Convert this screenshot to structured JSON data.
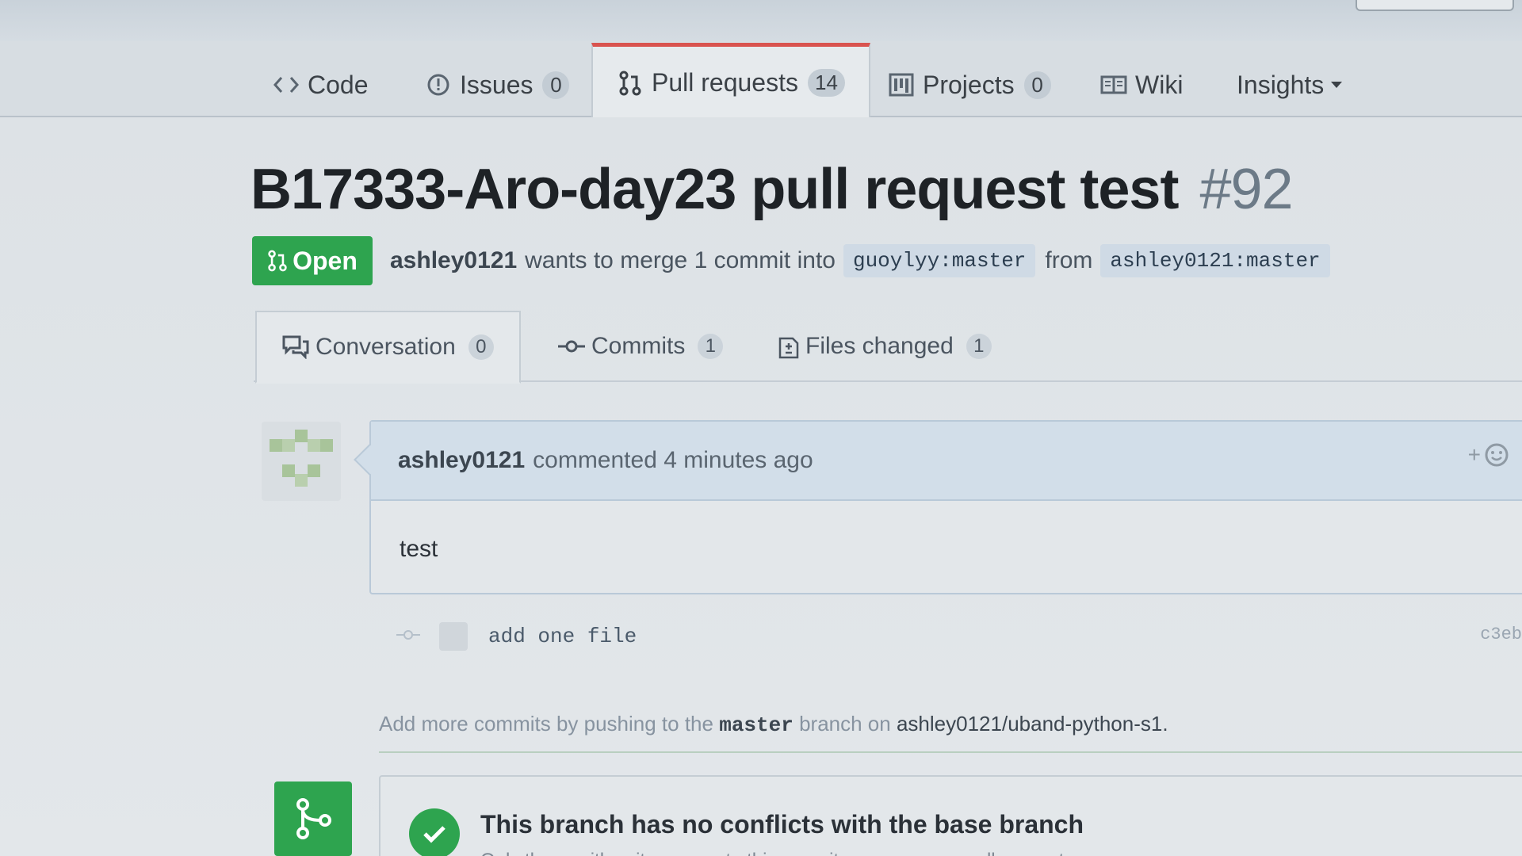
{
  "repo_nav": {
    "tabs": [
      {
        "label": "Code",
        "icon": "code-icon",
        "counter": null
      },
      {
        "label": "Issues",
        "icon": "issue-opened-icon",
        "counter": "0"
      },
      {
        "label": "Pull requests",
        "icon": "git-pull-request-icon",
        "counter": "14",
        "selected": true
      },
      {
        "label": "Projects",
        "icon": "project-icon",
        "counter": "0"
      },
      {
        "label": "Wiki",
        "icon": "book-icon",
        "counter": null
      },
      {
        "label": "Insights",
        "icon": "triangle-down-icon",
        "counter": null
      }
    ]
  },
  "pull_request": {
    "title": "B17333-Aro-day23 pull request test",
    "number": "#92",
    "state": "Open",
    "author": "ashley0121",
    "merge_text": "wants to merge 1 commit into",
    "base_branch": "guoylyy:master",
    "from_text": "from",
    "head_branch": "ashley0121:master"
  },
  "pr_tabs": [
    {
      "label": "Conversation",
      "icon": "comment-discussion-icon",
      "counter": "0",
      "selected": true
    },
    {
      "label": "Commits",
      "icon": "git-commit-icon",
      "counter": "1"
    },
    {
      "label": "Files changed",
      "icon": "diff-icon",
      "counter": "1"
    }
  ],
  "comment": {
    "author": "ashley0121",
    "action": "commented 4 minutes ago",
    "body": "test",
    "reaction_label": "+"
  },
  "commit": {
    "message": "add one file",
    "sha": "c3eb"
  },
  "push_hint": {
    "prefix": "Add more commits by pushing to the",
    "branch": "master",
    "middle": "branch on",
    "repo": "ashley0121/uband-python-s1."
  },
  "merge_status": {
    "title": "This branch has no conflicts with the base branch",
    "subtitle": "Only those with write access to this repository can merge pull requests."
  },
  "colors": {
    "open_green": "#2ea44f",
    "selected_tab_accent": "#d9534f",
    "branch_bg": "#cfdae5"
  }
}
